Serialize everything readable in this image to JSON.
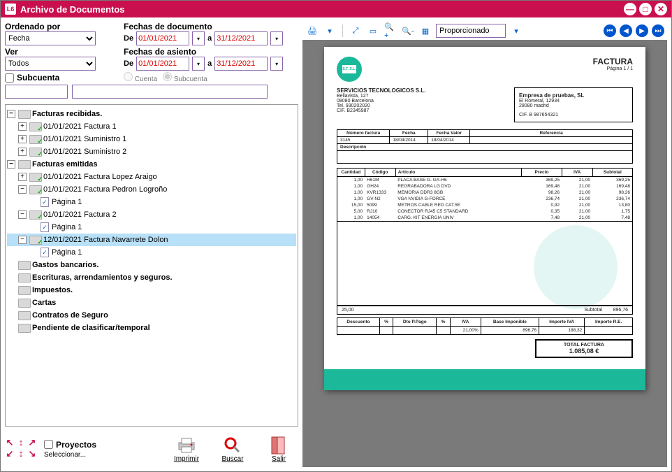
{
  "window": {
    "title": "Archivo de Documentos"
  },
  "filters": {
    "ordenado_label": "Ordenado por",
    "ordenado_value": "Fecha",
    "ver_label": "Ver",
    "ver_value": "Todos",
    "subcuenta_label": "Subcuenta",
    "fechas_doc_label": "Fechas de documento",
    "fechas_asiento_label": "Fechas de asiento",
    "de": "De",
    "a": "a",
    "date_from": "01/01/2021",
    "date_to": "31/12/2021",
    "radio_cuenta": "Cuenta",
    "radio_subcuenta": "Subcuenta"
  },
  "tree": {
    "n0": "Facturas recibidas.",
    "n0_0": "01/01/2021 Factura 1",
    "n0_1": "01/01/2021 Suministro 1",
    "n0_2": "01/01/2021 Suministro 2",
    "n1": "Facturas emitidas",
    "n1_0": "01/01/2021 Factura Lopez Araigo",
    "n1_1": "01/01/2021 Factura Pedron Logroño",
    "n1_1_p": "Página 1",
    "n1_2": "01/01/2021 Factura 2",
    "n1_2_p": "Página 1",
    "n1_3": "12/01/2021 Factura Navarrete Dolon",
    "n1_3_p": "Página 1",
    "n2": "Gastos bancarios.",
    "n3": "Escrituras, arrendamientos y seguros.",
    "n4": "Impuestos.",
    "n5": "Cartas",
    "n6": "Contratos de Seguro",
    "n7": "Pendiente de clasificar/temporal"
  },
  "bottom": {
    "proyectos": "Proyectos",
    "seleccionar": "Seleccionar...",
    "imprimir": "Imprimir",
    "buscar": "Buscar",
    "salir": "Salir"
  },
  "toolbar": {
    "zoom_mode": "Proporcionado"
  },
  "invoice": {
    "logo_text": "S.T. S.L.",
    "title": "FACTURA",
    "page": "Página  1 /  1",
    "company_name": "SERVICIOS TECNOLOGICOS S.L.",
    "addr1": "Bellavista, 127",
    "addr2": "08080 Barcelona",
    "tel": "Tel.  930202020",
    "cif": "CIF. B2345987",
    "client_name": "Empresa de pruebas, SL",
    "client_addr1": "El Romeral, 12934",
    "client_addr2": "28080 madrid",
    "client_cif": "CIF. B 987654321",
    "hdr": {
      "num_lbl": "Número factura",
      "fecha_lbl": "Fecha",
      "fechav_lbl": "Fecha Valor",
      "ref_lbl": "Referencia",
      "num": "3145",
      "fecha": "18/04/2014",
      "fechav": "18/04/2014",
      "desc_lbl": "Descripción"
    },
    "cols": {
      "cant": "Cantidad",
      "cod": "Código",
      "art": "Artículo",
      "precio": "Precio",
      "iva": "IVA",
      "subtotal": "Subtotal"
    },
    "lines": [
      {
        "cant": "1,00",
        "cod": "H61M",
        "art": "PLACA BASE G. GA-H6",
        "precio": "369,25",
        "iva": "21,00",
        "sub": "369,25"
      },
      {
        "cant": "1,00",
        "cod": "GH24",
        "art": "REGRABADORA LG DVD",
        "precio": "169,48",
        "iva": "21,00",
        "sub": "169,48"
      },
      {
        "cant": "1,00",
        "cod": "KVR1333",
        "art": "MEMORIA DDR3 8GB",
        "precio": "98,26",
        "iva": "21,00",
        "sub": "98,26"
      },
      {
        "cant": "1,00",
        "cod": "GV-N2",
        "art": "VGA NVIDIA G-FORCE",
        "precio": "236,74",
        "iva": "21,00",
        "sub": "236,74"
      },
      {
        "cant": "15,00",
        "cod": "5099",
        "art": "METROS CABLE RED CAT.5E",
        "precio": "0,92",
        "iva": "21,00",
        "sub": "13,80"
      },
      {
        "cant": "5,00",
        "cod": "RJ10",
        "art": "CONECTOR RJ45 C5 STANDARD",
        "precio": "0,35",
        "iva": "21,00",
        "sub": "1,75"
      },
      {
        "cant": "1,00",
        "cod": "14054",
        "art": "CARG. KIT ENERGIA UNIV",
        "precio": "7,48",
        "iva": "21,00",
        "sub": "7,48"
      }
    ],
    "sum_qty": "25,00",
    "sum_lbl": "Subtotal",
    "sum_val": "896,76",
    "tot_hdr": {
      "desc": "Descuento",
      "pct": "%",
      "dtop": "Dto P.Pago",
      "pct2": "%",
      "iva": "IVA",
      "ivap": "21,00%",
      "base": "Base Imponible",
      "basev": "896,76",
      "impiva": "Importe IVA",
      "impivav": "188,32",
      "re": "Importe R.E."
    },
    "grand_lbl": "TOTAL FACTURA",
    "grand_val": "1.085,08 €"
  }
}
